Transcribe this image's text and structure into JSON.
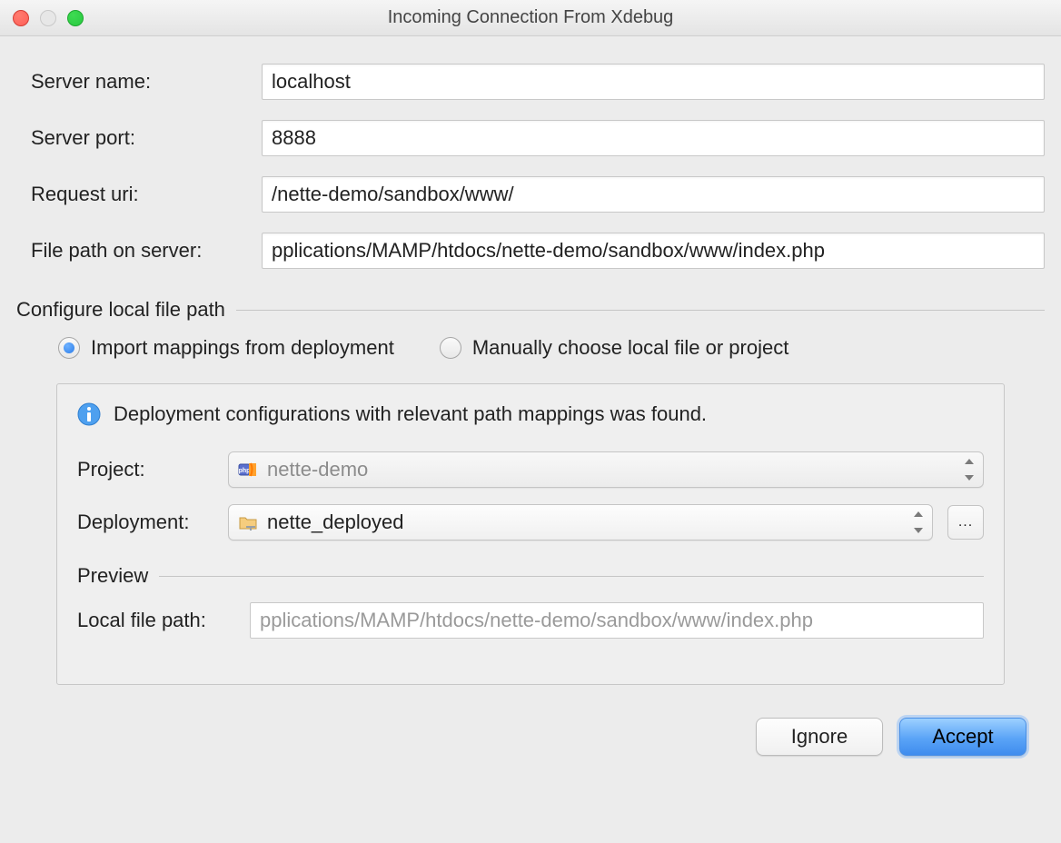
{
  "window": {
    "title": "Incoming Connection From Xdebug"
  },
  "form": {
    "server_name_label": "Server name:",
    "server_name_value": "localhost",
    "server_port_label": "Server port:",
    "server_port_value": "8888",
    "request_uri_label": "Request uri:",
    "request_uri_value": "/nette-demo/sandbox/www/",
    "file_path_label": "File path on server:",
    "file_path_value": "pplications/MAMP/htdocs/nette-demo/sandbox/www/index.php"
  },
  "section_title": "Configure local file path",
  "radios": {
    "import_label": "Import mappings from deployment",
    "manual_label": "Manually choose local file or project",
    "selected": "import"
  },
  "panel": {
    "info_text": "Deployment configurations with relevant path mappings was found.",
    "project_label": "Project:",
    "project_value": "nette-demo",
    "deployment_label": "Deployment:",
    "deployment_value": "nette_deployed",
    "ellipsis": "...",
    "preview_title": "Preview",
    "local_path_label": "Local file path:",
    "local_path_value": "pplications/MAMP/htdocs/nette-demo/sandbox/www/index.php"
  },
  "buttons": {
    "ignore": "Ignore",
    "accept": "Accept"
  }
}
